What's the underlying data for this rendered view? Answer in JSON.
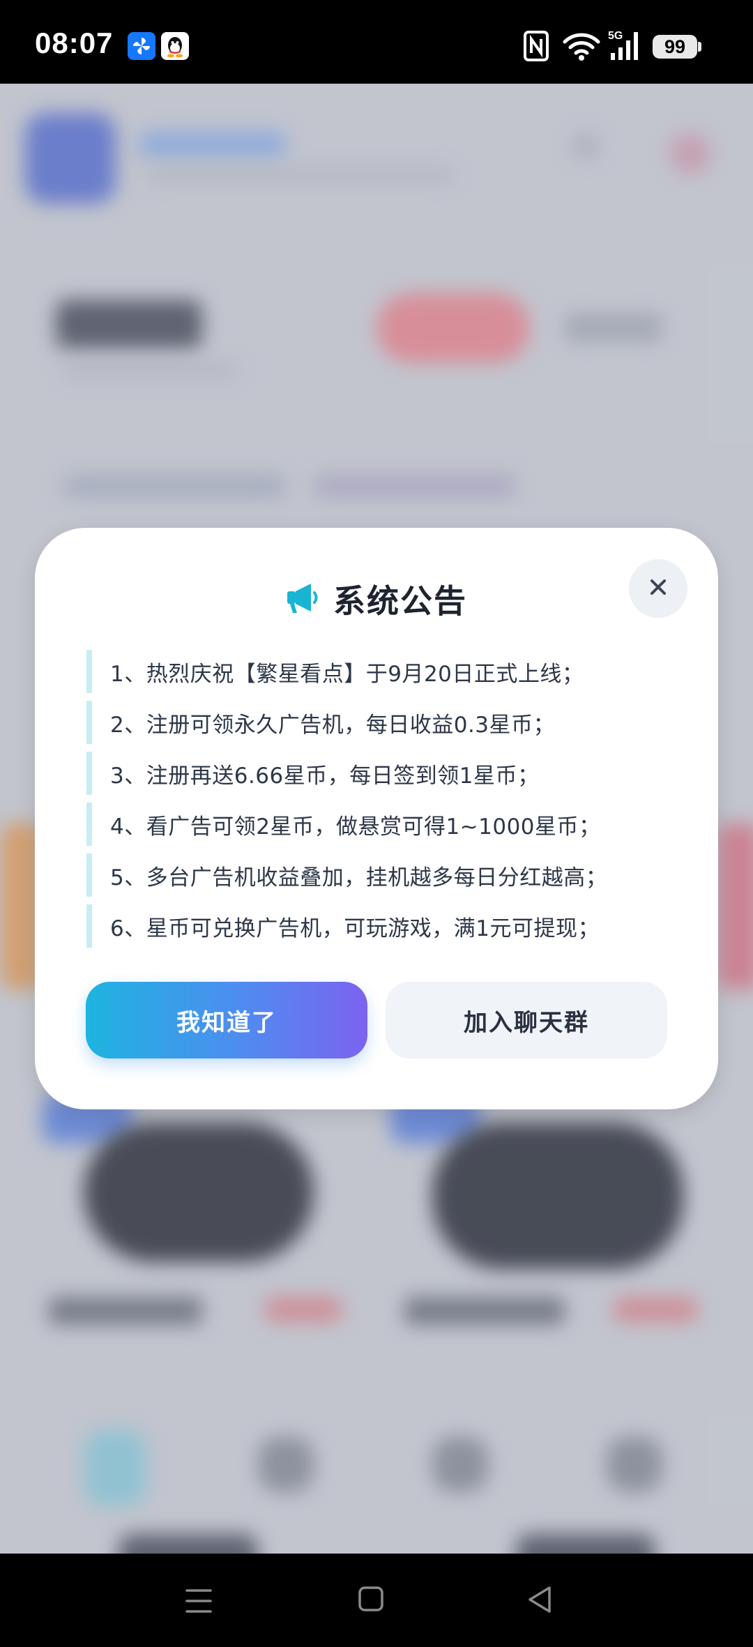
{
  "status_bar": {
    "time": "08:07",
    "battery": "99",
    "icons": [
      "pinwheel-app-icon",
      "qq-app-icon",
      "nfc-icon",
      "wifi-icon",
      "5g-signal-icon",
      "battery-icon"
    ]
  },
  "dialog": {
    "title": "系统公告",
    "title_icon": "megaphone-icon",
    "items": [
      "1、热烈庆祝【繁星看点】于9月20日正式上线；",
      "2、注册可领永久广告机，每日收益0.3星币；",
      "3、注册再送6.66星币，每日签到领1星币；",
      "4、看广告可领2星币，做悬赏可得1~1000星币；",
      "5、多台广告机收益叠加，挂机越多每日分红越高；",
      "6、星币可兑换广告机，可玩游戏，满1元可提现；"
    ],
    "primary_button": "我知道了",
    "secondary_button": "加入聊天群"
  },
  "colors": {
    "accent": "#19b4d2",
    "primary_gradient_start": "#1db4e0",
    "primary_gradient_end": "#7c62f0",
    "item_bar": "#c7eef2"
  },
  "nav_bar": {
    "icons": [
      "menu-icon",
      "home-square-icon",
      "back-triangle-icon"
    ]
  }
}
